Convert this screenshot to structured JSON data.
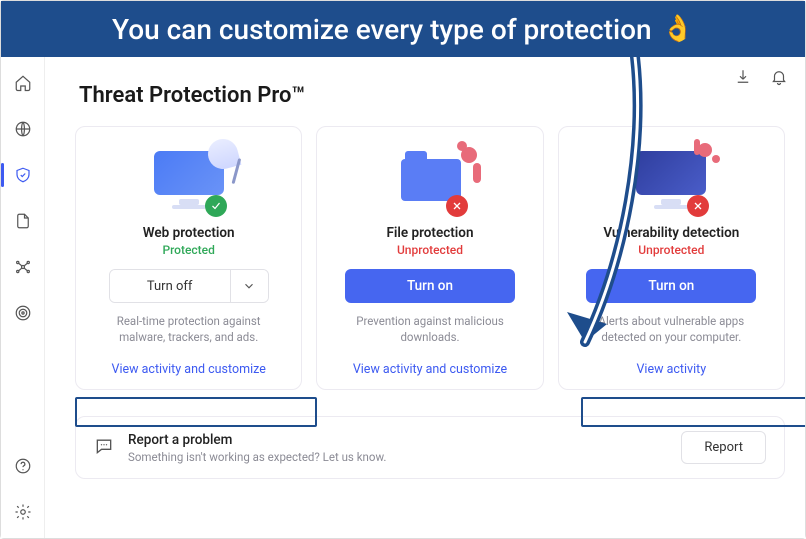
{
  "banner": {
    "text": "You can customize every type of protection",
    "emoji": "👌"
  },
  "page": {
    "title": "Threat Protection Pro™"
  },
  "sidebar": {
    "items": [
      {
        "name": "home",
        "icon": "home"
      },
      {
        "name": "globe",
        "icon": "globe"
      },
      {
        "name": "shield",
        "icon": "shield",
        "active": true
      },
      {
        "name": "file",
        "icon": "file"
      },
      {
        "name": "mesh",
        "icon": "mesh"
      },
      {
        "name": "target",
        "icon": "target"
      }
    ],
    "bottom": [
      {
        "name": "help",
        "icon": "help"
      },
      {
        "name": "settings",
        "icon": "gear"
      }
    ]
  },
  "topbar": {
    "download_icon": "download",
    "bell_icon": "bell"
  },
  "cards": {
    "web": {
      "title": "Web protection",
      "status": "Protected",
      "turnoff_label": "Turn off",
      "desc": "Real-time protection against malware, trackers, and ads.",
      "link": "View activity and customize"
    },
    "file": {
      "title": "File protection",
      "status": "Unprotected",
      "turnon_label": "Turn on",
      "desc": "Prevention against malicious downloads.",
      "link": "View activity and customize"
    },
    "vuln": {
      "title": "Vulnerability detection",
      "status": "Unprotected",
      "turnon_label": "Turn on",
      "desc": "Alerts about vulnerable apps detected on your computer.",
      "link": "View activity"
    }
  },
  "report": {
    "title": "Report a problem",
    "subtitle": "Something isn't working as expected? Let us know.",
    "button": "Report"
  }
}
